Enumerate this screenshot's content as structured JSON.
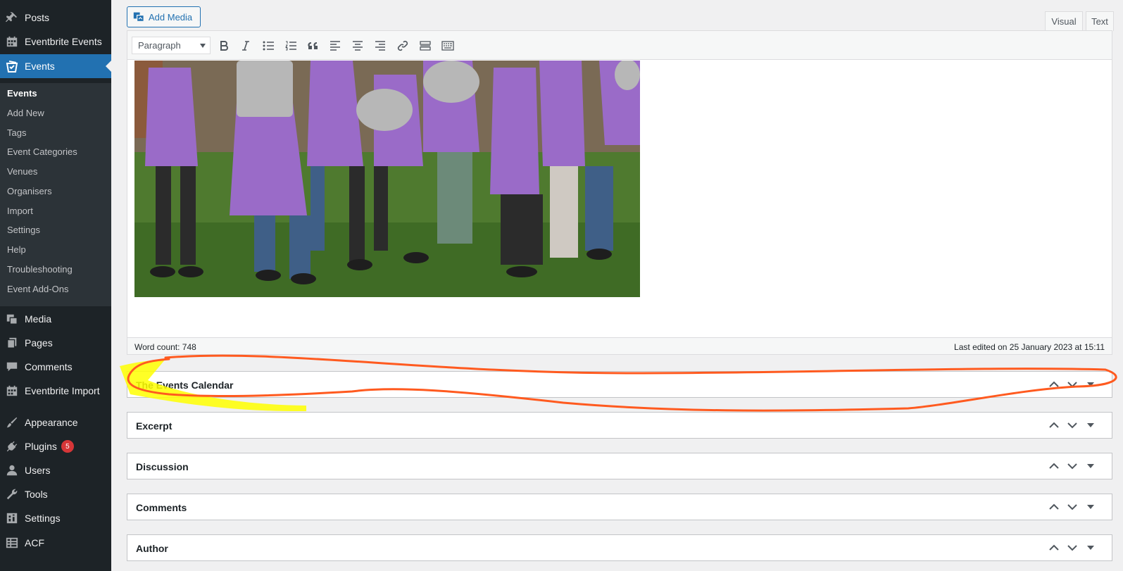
{
  "sidebar": {
    "items": [
      {
        "label": "Posts",
        "icon": "pin-icon"
      },
      {
        "label": "Eventbrite Events",
        "icon": "calendar-icon"
      },
      {
        "label": "Events",
        "icon": "events-icon"
      },
      {
        "label": "Media",
        "icon": "media-icon"
      },
      {
        "label": "Pages",
        "icon": "pages-icon"
      },
      {
        "label": "Comments",
        "icon": "comment-icon"
      },
      {
        "label": "Eventbrite Import",
        "icon": "calendar-icon"
      },
      {
        "label": "Appearance",
        "icon": "brush-icon"
      },
      {
        "label": "Plugins",
        "icon": "plugin-icon",
        "badge": "5"
      },
      {
        "label": "Users",
        "icon": "user-icon"
      },
      {
        "label": "Tools",
        "icon": "wrench-icon"
      },
      {
        "label": "Settings",
        "icon": "settings-icon"
      },
      {
        "label": "ACF",
        "icon": "table-icon"
      }
    ],
    "submenu": [
      "Events",
      "Add New",
      "Tags",
      "Event Categories",
      "Venues",
      "Organisers",
      "Import",
      "Settings",
      "Help",
      "Troubleshooting",
      "Event Add-Ons"
    ]
  },
  "editor": {
    "add_media": "Add Media",
    "tabs": {
      "visual": "Visual",
      "text": "Text"
    },
    "format": "Paragraph",
    "word_count": "Word count: 748",
    "last_edited": "Last edited on 25 January 2023 at 15:11"
  },
  "metaboxes": [
    "The Events Calendar",
    "Excerpt",
    "Discussion",
    "Comments",
    "Author"
  ],
  "colors": {
    "sidebar_bg": "#1d2327",
    "submenu_bg": "#2c3338",
    "accent": "#2271b1",
    "badge": "#d63638",
    "annotation_orange": "#ff5a1f",
    "annotation_yellow": "#ffff00",
    "apron_purple": "#9a6bc8",
    "grass": "#4f7a2f"
  }
}
